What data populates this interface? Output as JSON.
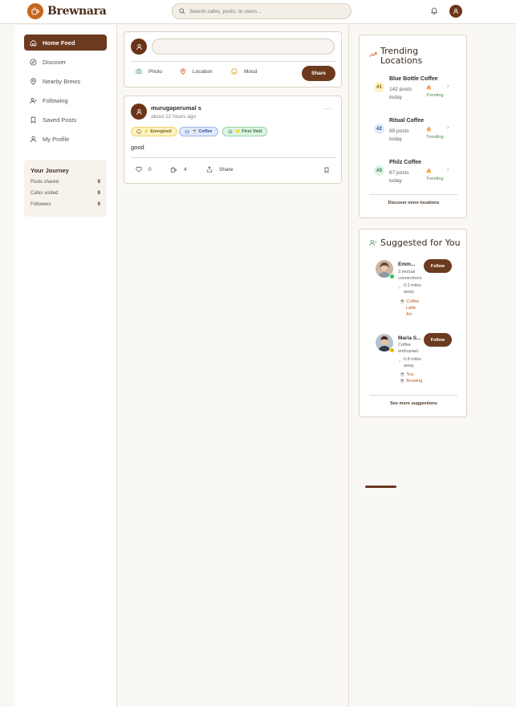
{
  "header": {
    "brand": "Brewnara",
    "search_placeholder": "Search cafes, posts, or users..."
  },
  "sidebar": {
    "items": [
      {
        "label": "Home Feed",
        "icon": "home-icon",
        "active": true
      },
      {
        "label": "Discover",
        "icon": "compass-icon"
      },
      {
        "label": "Nearby Brews",
        "icon": "map-pin-icon"
      },
      {
        "label": "Following",
        "icon": "user-follow-icon"
      },
      {
        "label": "Saved Posts",
        "icon": "bookmark-icon"
      },
      {
        "label": "My Profile",
        "icon": "user-icon"
      }
    ],
    "journey": {
      "title": "Your Journey",
      "stats": [
        {
          "label": "Posts shared",
          "value": "0"
        },
        {
          "label": "Cafes visited",
          "value": "0"
        },
        {
          "label": "Followers",
          "value": "0"
        }
      ]
    }
  },
  "composer": {
    "input_value": "",
    "actions": [
      {
        "label": "Photo",
        "icon": "camera-icon"
      },
      {
        "label": "Location",
        "icon": "map-pin-icon"
      },
      {
        "label": "Mood",
        "icon": "smile-icon"
      }
    ],
    "share_label": "Share"
  },
  "post": {
    "author": "murugaperumal s",
    "time": "about 22 hours ago",
    "tags": [
      {
        "label": "⚡ Energized",
        "icon": "smile-icon"
      },
      {
        "label": "☕ Coffee",
        "icon": "cup-icon"
      },
      {
        "label": "⭐ First Visit",
        "icon": "star-icon"
      }
    ],
    "text": "good",
    "likes": "0",
    "cups": "4",
    "share_label": "Share",
    "more": "···"
  },
  "trending": {
    "title_line1": "Trending",
    "title_line2": "Locations",
    "locations": [
      {
        "rank": "#1",
        "name": "Blue Bottle Coffee",
        "posts_line1": "142 posts",
        "posts_line2": "today",
        "trend": "Trending"
      },
      {
        "rank": "#2",
        "name": "Ritual Coffee",
        "posts_line1": "89 posts",
        "posts_line2": "today",
        "trend": "Trending"
      },
      {
        "rank": "#3",
        "name": "Philz Coffee",
        "posts_line1": "67 posts",
        "posts_line2": "today",
        "trend": "Trending"
      }
    ],
    "link": "Discover more locations"
  },
  "suggestions": {
    "title": "Suggested for You",
    "people": [
      {
        "name": "Emm...",
        "desc_line1": "3 mutual",
        "desc_line2": "connections",
        "dist_line1": "0.2 miles",
        "dist_line2": "away",
        "interests": [
          "Coffee",
          "Latte",
          "Art"
        ],
        "status_color": "#22c55e"
      },
      {
        "name": "Maria S...",
        "desc_line1": "Coffee",
        "desc_line2": "enthusiast",
        "dist_line1": "0.8 miles",
        "dist_line2": "away",
        "interests": [
          "Tea",
          "Brewing"
        ],
        "status_color": "#eab308"
      }
    ],
    "follow_label": "Follow",
    "link": "See more suggestions"
  },
  "colors": {
    "accent": "#6b3a1f",
    "logo": "#c8651d"
  }
}
